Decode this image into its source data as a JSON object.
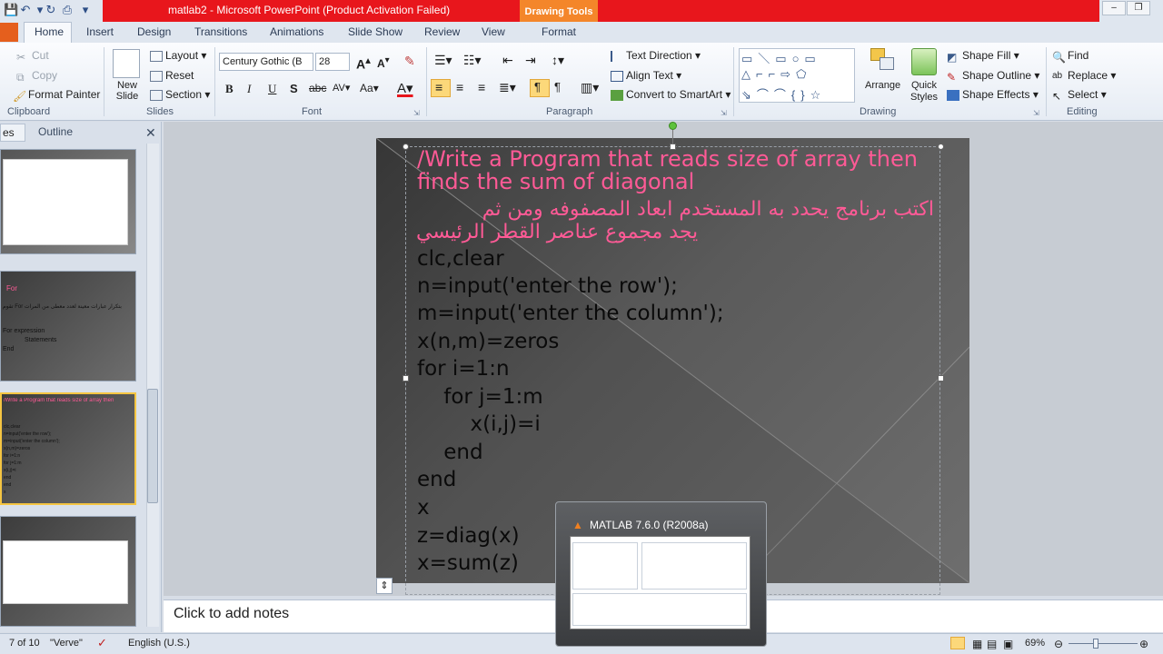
{
  "window": {
    "title": "matlab2  -  Microsoft PowerPoint (Product Activation Failed)",
    "contextual_tab": "Drawing Tools",
    "min": "‒",
    "restore": "❐"
  },
  "tabs": [
    "Home",
    "Insert",
    "Design",
    "Transitions",
    "Animations",
    "Slide Show",
    "Review",
    "View",
    "Format"
  ],
  "ribbon": {
    "clipboard": {
      "cut": "Cut",
      "copy": "Copy",
      "format_painter": "Format Painter",
      "label": "Clipboard"
    },
    "slides": {
      "new_slide": "New Slide",
      "layout": "Layout",
      "reset": "Reset",
      "section": "Section",
      "label": "Slides"
    },
    "font": {
      "name": "Century Gothic (B",
      "size": "28",
      "label": "Font",
      "bold": "B",
      "italic": "I",
      "underline": "U",
      "shadow": "S",
      "strike": "abc",
      "spacing": "AV",
      "case": "Aa"
    },
    "paragraph": {
      "text_direction": "Text Direction",
      "align_text": "Align Text",
      "convert": "Convert to SmartArt",
      "label": "Paragraph"
    },
    "drawing": {
      "arrange": "Arrange",
      "quick_styles": "Quick Styles",
      "shape_fill": "Shape Fill",
      "shape_outline": "Shape Outline",
      "shape_effects": "Shape Effects",
      "label": "Drawing"
    },
    "editing": {
      "find": "Find",
      "replace": "Replace",
      "select": "Select",
      "label": "Editing"
    }
  },
  "panel": {
    "tab_slides": "es",
    "tab_outline": "Outline"
  },
  "slide": {
    "title_en_1": "/Write a Program that reads size of array then",
    "title_en_2": "finds the sum of diagonal",
    "title_ar_1": "اكتب برنامج يحدد به المستخدم ابعاد المصفوفه ومن ثم",
    "title_ar_2": "يجد مجموع عناصر القطر الرئيسي",
    "code": [
      "clc,clear",
      "n=input('enter the row');",
      "m=input('enter the column');",
      "x(n,m)=zeros",
      "for i=1:n",
      "    for j=1:m",
      "        x(i,j)=i",
      "    end",
      "end",
      "x",
      "z=diag(x)",
      "x=sum(z)"
    ]
  },
  "thumb2": {
    "heading": "For",
    "text1": "تقوم For بتكرار عبارات معينة لعدد معطى من المرات",
    "text2": "For expression",
    "text3": "Statements",
    "text4": "End"
  },
  "notes": "Click to add notes",
  "status": {
    "slide": "7 of 10",
    "theme": "\"Verve\"",
    "language": "English (U.S.)",
    "zoom": "69%"
  },
  "popup": {
    "title": "MATLAB  7.6.0 (R2008a)"
  },
  "colors": {
    "title_red": "#e8161c",
    "accent_orange": "#f4862a",
    "slide_pink": "#ff5a96"
  }
}
